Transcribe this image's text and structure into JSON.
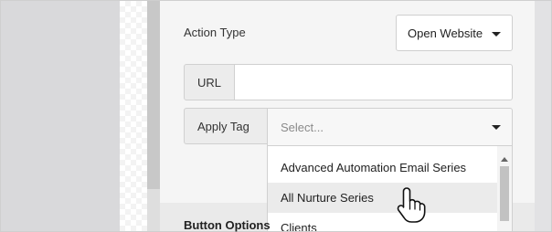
{
  "form": {
    "action_type_label": "Action Type",
    "action_type_value": "Open Website",
    "url_label": "URL",
    "url_value": "",
    "apply_tag_label": "Apply Tag",
    "apply_tag_placeholder": "Select..."
  },
  "dropdown": {
    "items": [
      "Advanced Automation Email Series",
      "All Nurture Series",
      "Clients"
    ],
    "highlighted_index": 1
  },
  "sections": {
    "button_options_label": "Button Options"
  },
  "icons": {
    "caret": "chevron-down-icon",
    "cursor": "hand-pointer-icon"
  }
}
